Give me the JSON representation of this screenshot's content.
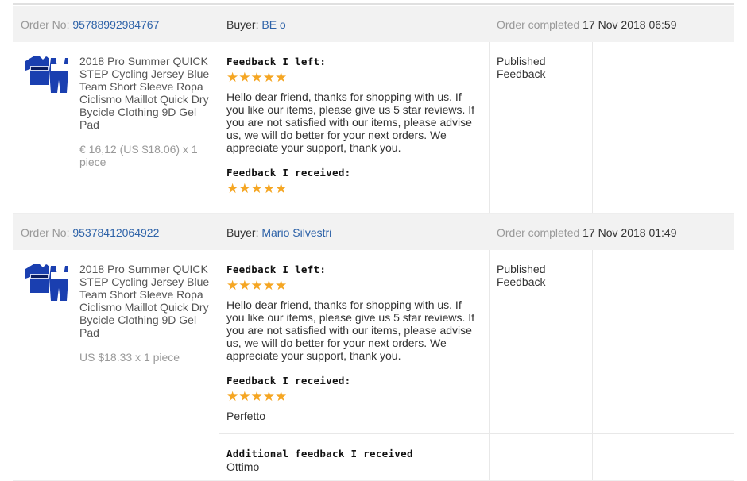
{
  "orders": [
    {
      "order_no_label": "Order No:",
      "order_no": "95788992984767",
      "buyer_label": "Buyer:",
      "buyer": "BE o",
      "completed_label": "Order completed",
      "completed_time": "17 Nov 2018 06:59",
      "product_name": "2018 Pro Summer QUICK STEP Cycling Jersey Blue Team Short Sleeve Ropa Ciclismo Maillot Quick Dry Bycicle Clothing 9D Gel Pad",
      "price": "€ 16,12 (US $18.06) x 1 piece",
      "feedback_left_label": "Feedback I left:",
      "feedback_left_stars": "★★★★★",
      "feedback_left_text": "Hello dear friend, thanks for shopping with us. If you like our items, please give us 5 star reviews. If you are not satisfied with our items, please advise us, we will do better for your next orders. We appreciate your support, thank you.",
      "feedback_received_label": "Feedback I received:",
      "feedback_received_stars": "★★★★★",
      "feedback_received_text": "",
      "status": "Published Feedback"
    },
    {
      "order_no_label": "Order No:",
      "order_no": "95378412064922",
      "buyer_label": "Buyer:",
      "buyer": "Mario Silvestri",
      "completed_label": "Order completed",
      "completed_time": "17 Nov 2018 01:49",
      "product_name": "2018 Pro Summer QUICK STEP Cycling Jersey Blue Team Short Sleeve Ropa Ciclismo Maillot Quick Dry Bycicle Clothing 9D Gel Pad",
      "price": "US $18.33 x 1 piece",
      "feedback_left_label": "Feedback I left:",
      "feedback_left_stars": "★★★★★",
      "feedback_left_text": "Hello dear friend, thanks for shopping with us. If you like our items, please give us 5 star reviews. If you are not satisfied with our items, please advise us, we will do better for your next orders. We appreciate your support, thank you.",
      "feedback_received_label": "Feedback I received:",
      "feedback_received_stars": "★★★★★",
      "feedback_received_text": "Perfetto",
      "additional_label": "Additional feedback I received",
      "additional_text": "Ottimo",
      "status": "Published Feedback"
    }
  ],
  "colors": {
    "link": "#2d62a8",
    "star": "#f5a623",
    "header_bg": "#f2f2f2",
    "jersey": "#1a3fb0"
  },
  "icons": {
    "product_thumb": "cycling-jersey-kit-image"
  }
}
